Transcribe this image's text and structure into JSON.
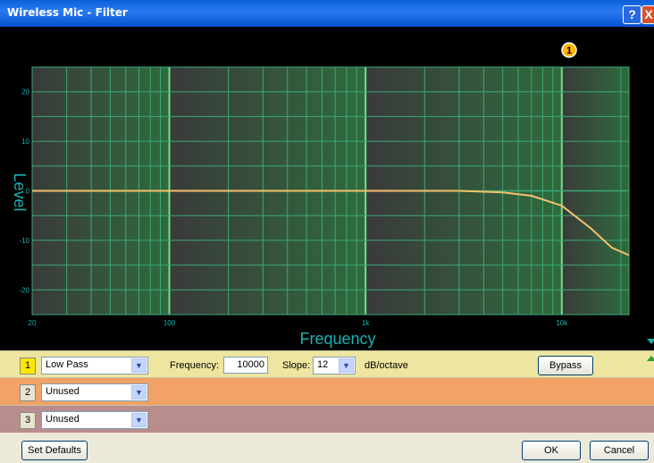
{
  "window": {
    "title": "Wireless Mic - Filter",
    "help_label": "?",
    "close_label": "X"
  },
  "graph": {
    "ylabel": "Level",
    "xlabel": "Frequency",
    "marker": "1",
    "y_ticks": [
      "20",
      "10",
      "0",
      "-10",
      "-20"
    ],
    "x_ticks": [
      "20",
      "100",
      "1k",
      "10k"
    ],
    "xlim_hz": [
      20,
      22000
    ],
    "ylim_db": [
      -25,
      25
    ],
    "colors": {
      "grid": "#3aa87a",
      "curve": "#f5c26b",
      "axis_text": "#19b3b3",
      "marker": "#ffb400"
    }
  },
  "chart_data": {
    "type": "line",
    "title": "",
    "xlabel": "Frequency",
    "ylabel": "Level",
    "x_scale": "log",
    "x_ticks": [
      "20",
      "100",
      "1k",
      "10k"
    ],
    "y_ticks": [
      20,
      10,
      0,
      -10,
      -20
    ],
    "xlim": [
      20,
      22000
    ],
    "ylim": [
      -25,
      25
    ],
    "grid": true,
    "series": [
      {
        "x": [
          20,
          100,
          1000,
          3000,
          5000,
          7000,
          10000,
          14000,
          18000,
          22000
        ],
        "y": [
          0,
          0,
          0,
          0,
          -0.3,
          -1,
          -3,
          -7.5,
          -11.5,
          -13
        ]
      }
    ]
  },
  "filters": [
    {
      "index": "1",
      "type": "Low Pass",
      "frequency_label": "Frequency:",
      "frequency": "10000",
      "slope_label": "Slope:",
      "slope": "12",
      "unit": "dB/octave",
      "bypass_label": "Bypass"
    },
    {
      "index": "2",
      "type": "Unused"
    },
    {
      "index": "3",
      "type": "Unused"
    }
  ],
  "footer": {
    "defaults_label": "Set Defaults",
    "ok_label": "OK",
    "cancel_label": "Cancel"
  }
}
